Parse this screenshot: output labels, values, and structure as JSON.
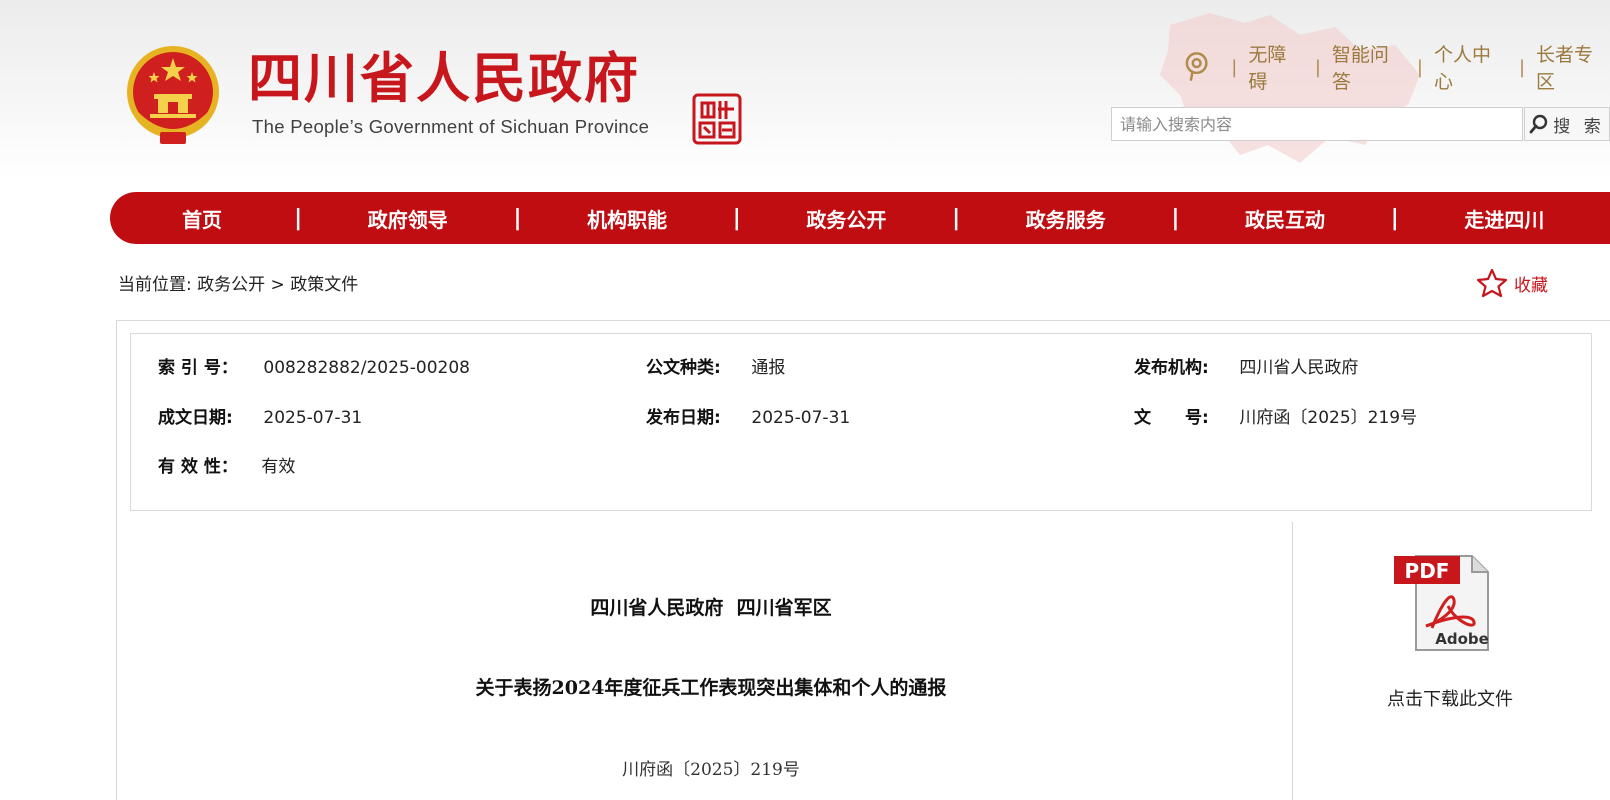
{
  "header": {
    "site_title": "四川省人民政府",
    "site_subtitle": "The People’s Government of Sichuan Province",
    "seal_text": "中国四川",
    "top_links": [
      "无障碍",
      "智能问答",
      "个人中心",
      "长者专区"
    ],
    "search": {
      "placeholder": "请输入搜索内容",
      "button_label": "搜 索"
    }
  },
  "nav": {
    "items": [
      "首页",
      "政府领导",
      "机构职能",
      "政务公开",
      "政务服务",
      "政民互动",
      "走进四川"
    ],
    "divider": "|"
  },
  "breadcrumb": {
    "prefix": "当前位置:",
    "level1": "政务公开",
    "separator": ">",
    "level2": "政策文件"
  },
  "favorite_label": "收藏",
  "meta": {
    "index_label": "索 引 号：",
    "index_value": "008282882/2025-00208",
    "type_label": "公文种类:",
    "type_value": "通报",
    "publisher_label": "发布机构:",
    "publisher_value": "四川省人民政府",
    "created_label": "成文日期:",
    "created_value": "2025-07-31",
    "published_label": "发布日期:",
    "published_value": "2025-07-31",
    "docno_label": "文　　号:",
    "docno_value": "川府函〔2025〕219号",
    "validity_label": "有 效 性：",
    "validity_value": "有效"
  },
  "document": {
    "issuer": "四川省人民政府  四川省军区",
    "title": "关于表扬2024年度征兵工作表现突出集体和个人的通报",
    "number": "川府函〔2025〕219号"
  },
  "download": {
    "pdf_label": "PDF",
    "adobe_label": "Adobe",
    "caption": "点击下载此文件"
  },
  "colors": {
    "brand_red": "#c00d12",
    "title_red": "#c8161d",
    "link_gold": "#9c7a3e"
  }
}
